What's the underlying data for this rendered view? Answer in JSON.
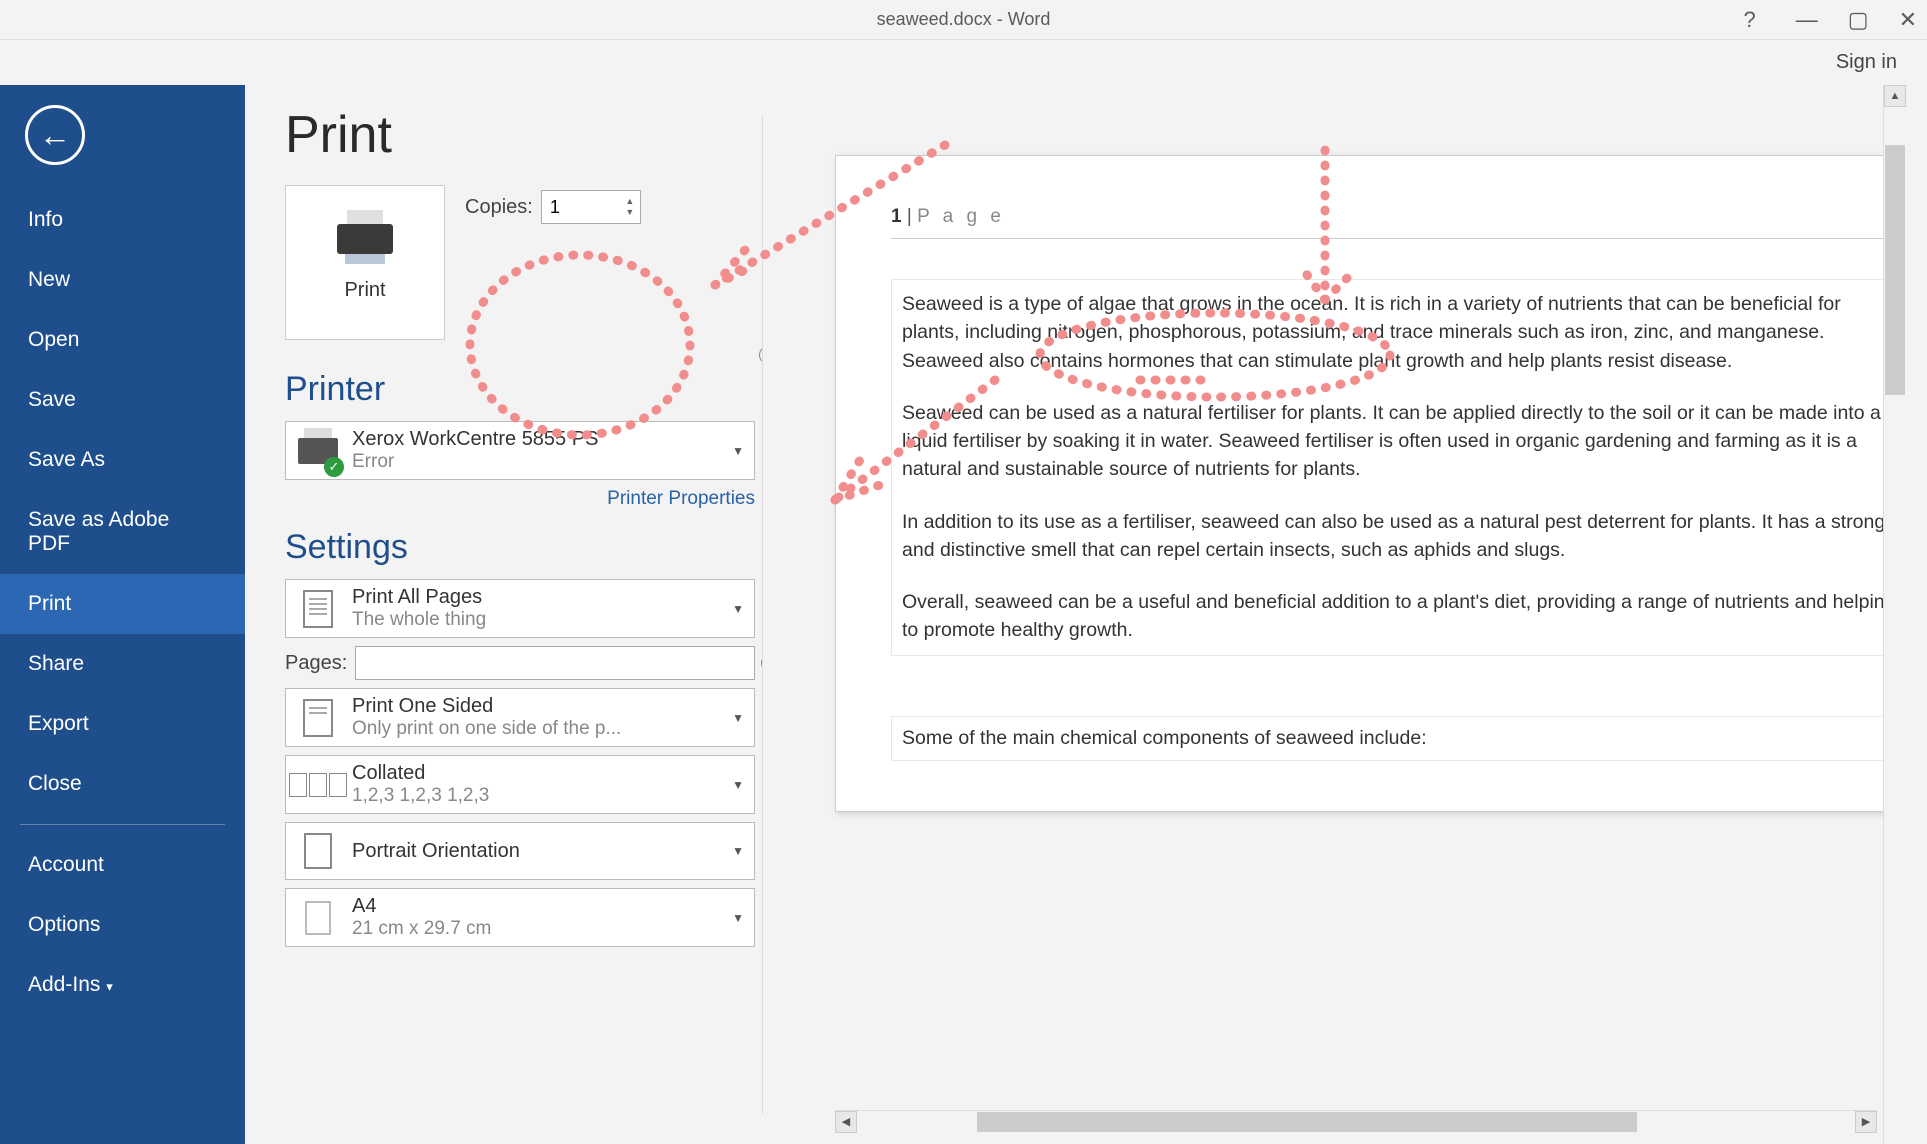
{
  "titlebar": {
    "title": "seaweed.docx - Word",
    "signin": "Sign in"
  },
  "sidebar": {
    "items": [
      {
        "label": "Info"
      },
      {
        "label": "New"
      },
      {
        "label": "Open"
      },
      {
        "label": "Save"
      },
      {
        "label": "Save As"
      },
      {
        "label": "Save as Adobe PDF"
      },
      {
        "label": "Print"
      },
      {
        "label": "Share"
      },
      {
        "label": "Export"
      },
      {
        "label": "Close"
      },
      {
        "label": "Account"
      },
      {
        "label": "Options"
      },
      {
        "label": "Add-Ins"
      }
    ]
  },
  "print": {
    "heading": "Print",
    "button_label": "Print",
    "copies_label": "Copies:",
    "copies_value": "1",
    "printer_heading": "Printer",
    "printer_name": "Xerox WorkCentre 5855 PS",
    "printer_status": "Error",
    "printer_props": "Printer Properties",
    "settings_heading": "Settings",
    "opt_scope_title": "Print All Pages",
    "opt_scope_sub": "The whole thing",
    "pages_label": "Pages:",
    "opt_sided_title": "Print One Sided",
    "opt_sided_sub": "Only print on one side of the p...",
    "opt_collate_title": "Collated",
    "opt_collate_sub": "1,2,3    1,2,3    1,2,3",
    "opt_orient_title": "Portrait Orientation",
    "opt_paper_title": "A4",
    "opt_paper_sub": "21 cm x 29.7 cm"
  },
  "preview": {
    "page_num": "1",
    "page_word": "P a g e",
    "p1": "Seaweed is a type of algae that grows in the ocean. It is rich in a variety of nutrients that can be beneficial for plants, including nitrogen, phosphorous, potassium, and trace minerals such as iron, zinc, and manganese. Seaweed also contains hormones that can stimulate plant growth and help plants resist disease.",
    "p2": "Seaweed can be used as a natural fertiliser for plants. It can be applied directly to the soil or it can be made into a liquid fertiliser by soaking it in water. Seaweed fertiliser is often used in organic gardening and farming as it is a natural and sustainable source of nutrients for plants.",
    "p3": "In addition to its use as a fertiliser, seaweed can also be used as a natural pest deterrent for plants. It has a strong and distinctive smell that can repel certain insects, such as aphids and slugs.",
    "p4": "Overall, seaweed can be a useful and beneficial addition to a plant's diet, providing a range of nutrients and helping to promote healthy growth.",
    "sec2": "Some of the main chemical components of seaweed include:"
  }
}
